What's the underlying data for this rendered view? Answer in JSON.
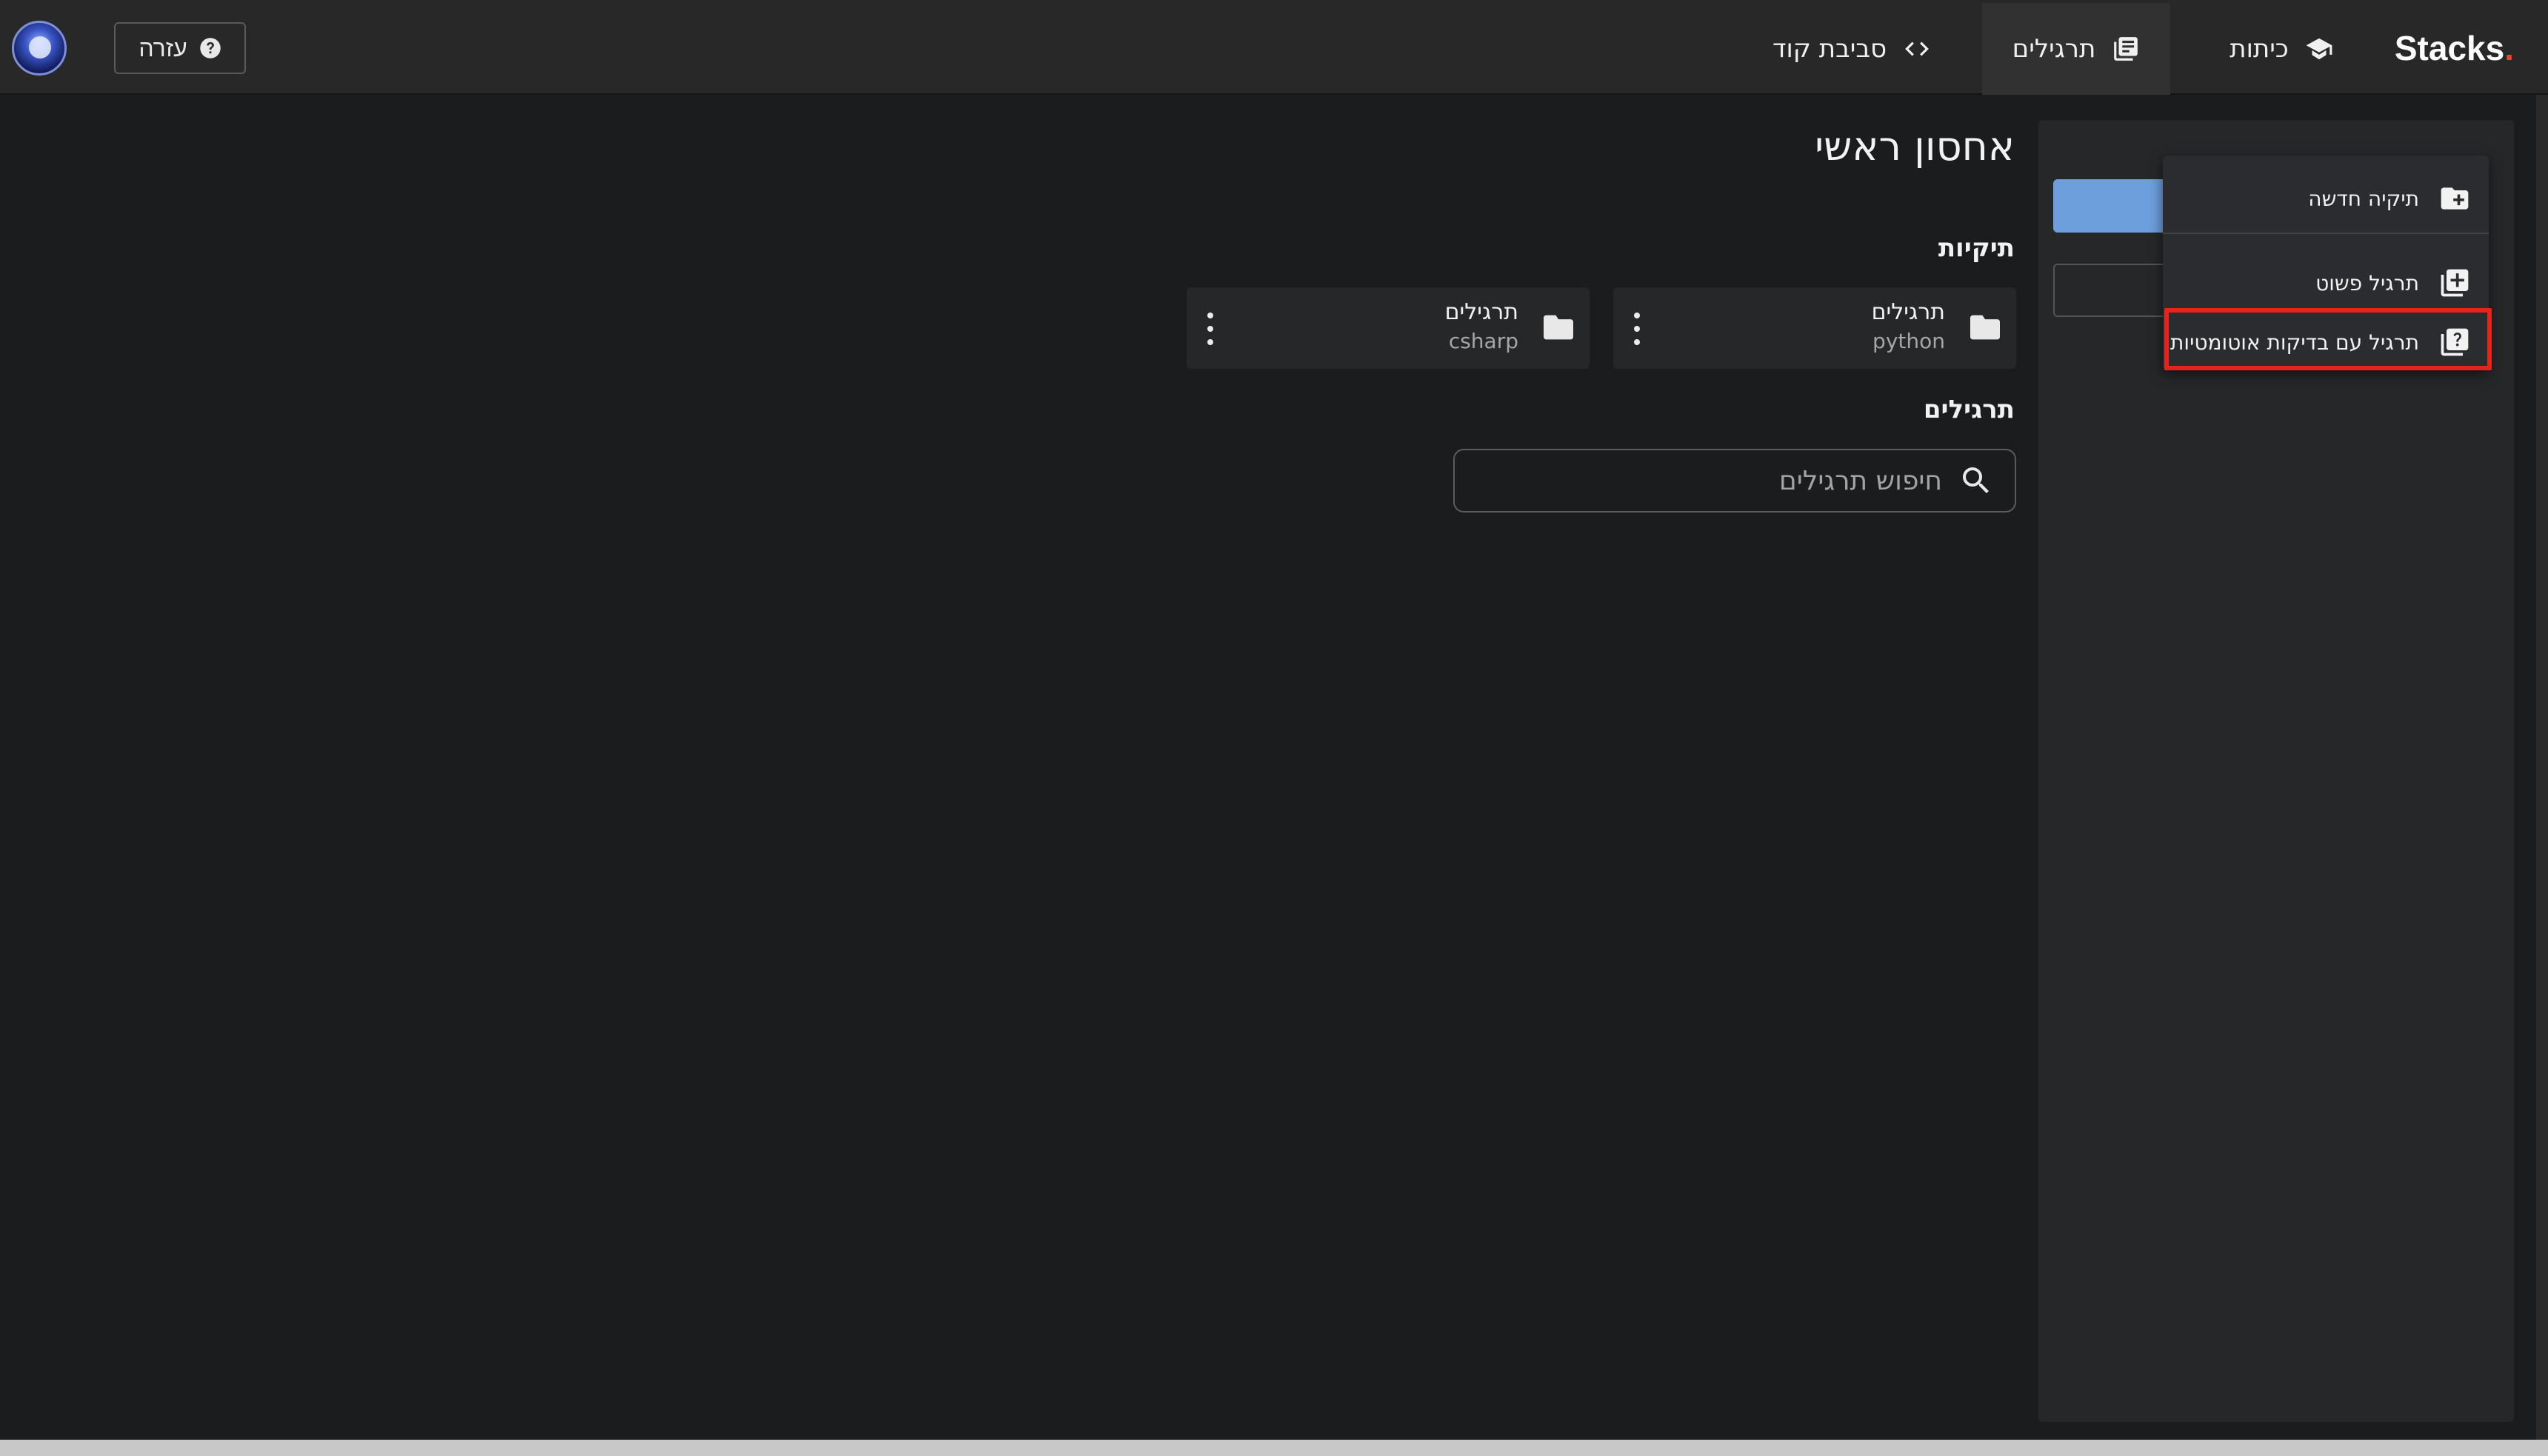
{
  "brand": {
    "name": "Stacks",
    "dot": "."
  },
  "nav": {
    "courses": "כיתות",
    "exercises": "תרגילים",
    "ide": "סביבת קוד"
  },
  "header": {
    "help_label": "עזרה"
  },
  "menu": {
    "new_folder": "תיקיה חדשה",
    "simple_exercise": "תרגיל פשוט",
    "auto_test_exercise": "תרגיל עם בדיקות אוטומטיות"
  },
  "main": {
    "title": "אחסון ראשי",
    "folders_title": "תיקיות",
    "exercises_title": "תרגילים",
    "folders": [
      {
        "name": "תרגילים",
        "sub": "python"
      },
      {
        "name": "תרגילים",
        "sub": "csharp"
      }
    ],
    "search_placeholder": "חיפוש תרגילים"
  },
  "colors": {
    "accent": "#6d9fdc",
    "highlight": "#e6241b",
    "brand_dot": "#ff3b30"
  }
}
